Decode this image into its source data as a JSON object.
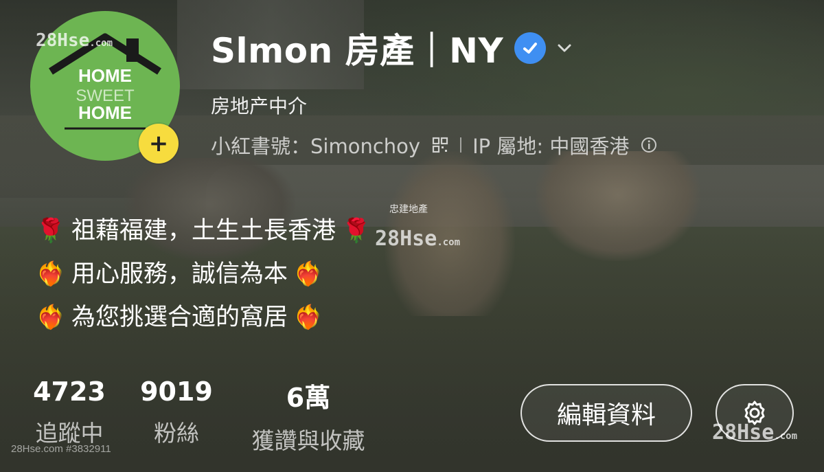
{
  "profile": {
    "name": "Slmon 房產｜NY",
    "occupation": "房地产中介",
    "account_id_label": "小紅書號：Simonchoy",
    "ip_label": "IP 屬地: 中國香港",
    "avatar_logo_lines": [
      "HOME",
      "SWEET",
      "HOME"
    ]
  },
  "bio": {
    "lines": [
      {
        "emoji_left": "🌹",
        "text": "祖藉福建，土生土長香港",
        "emoji_right": "🌹"
      },
      {
        "emoji_left": "❤️‍🔥",
        "text": "用心服務，誠信為本",
        "emoji_right": "❤️‍🔥"
      },
      {
        "emoji_left": "❤️‍🔥",
        "text": "為您挑選合適的窩居",
        "emoji_right": "❤️‍🔥"
      }
    ]
  },
  "stats": [
    {
      "value": "4723",
      "label": "追蹤中"
    },
    {
      "value": "9019",
      "label": "粉絲"
    },
    {
      "value": "6萬",
      "label": "獲讚與收藏"
    }
  ],
  "actions": {
    "edit_label": "編輯資料"
  },
  "watermarks": {
    "brand": "28Hse",
    "brand_suffix": ".com",
    "mid_label": "忠建地產",
    "footer": "28Hse.com #3832911"
  },
  "icons": {
    "verified": "verified-check-icon",
    "dropdown": "chevron-down-icon",
    "qr": "qr-code-icon",
    "info": "info-circle-icon",
    "settings": "gear-icon",
    "add": "plus-icon"
  },
  "colors": {
    "verified_blue": "#3f8ff2",
    "avatar_green": "#6db552",
    "add_badge_yellow": "#f7dc3e"
  }
}
